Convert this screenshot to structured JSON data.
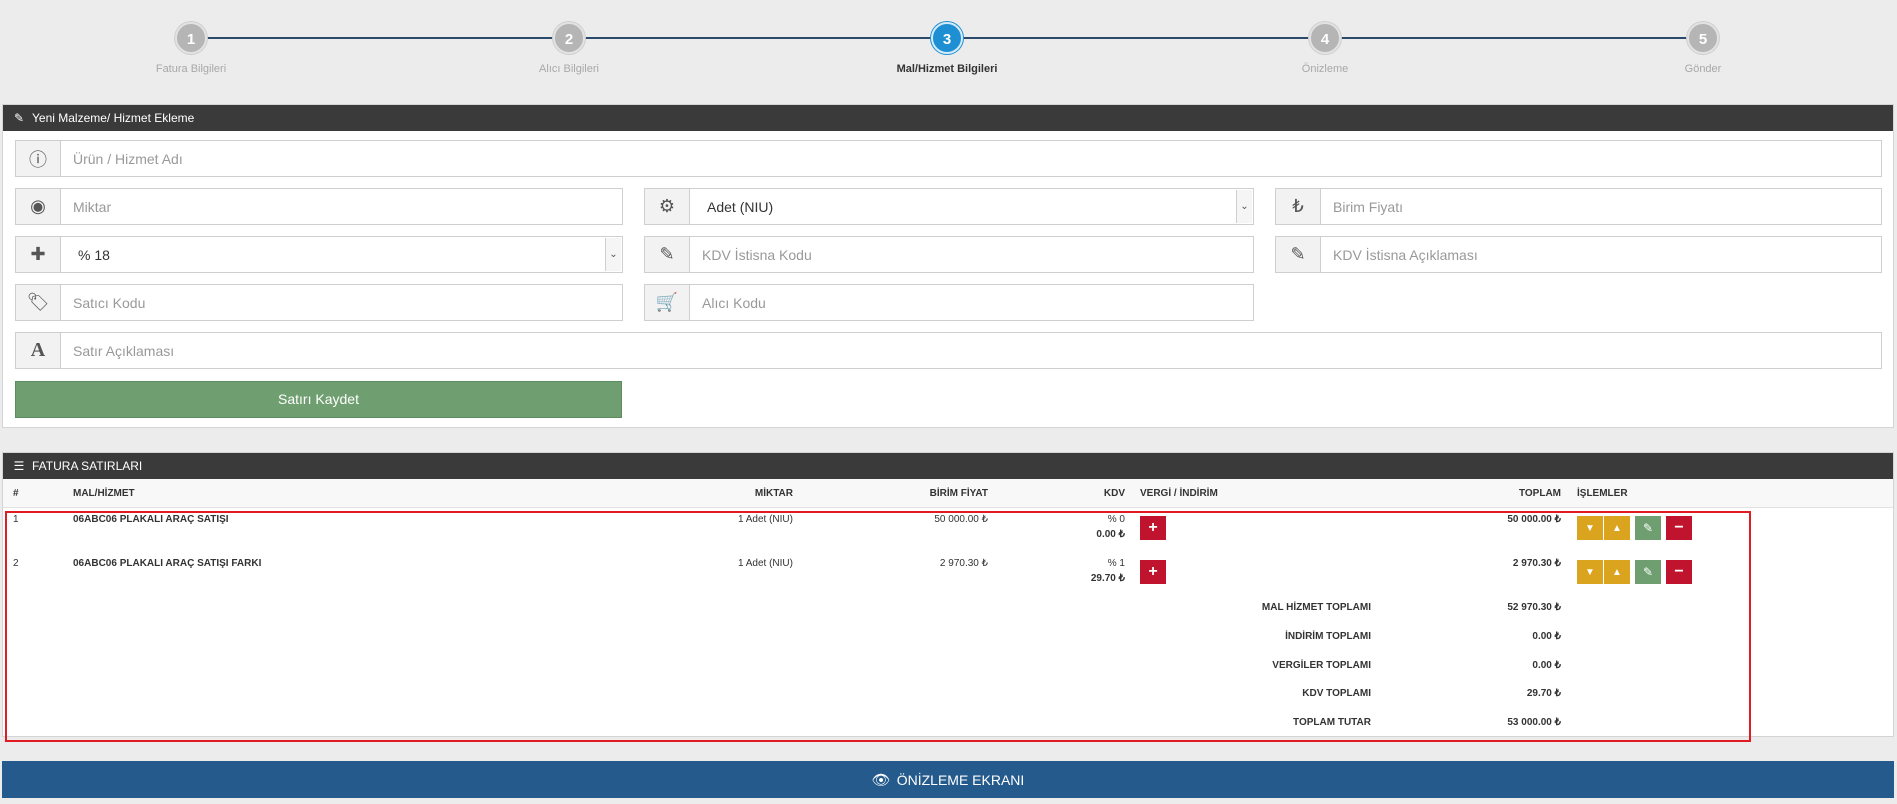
{
  "wizard": {
    "steps": [
      {
        "num": "1",
        "label": "Fatura Bilgileri"
      },
      {
        "num": "2",
        "label": "Alıcı Bilgileri"
      },
      {
        "num": "3",
        "label": "Mal/Hizmet Bilgileri"
      },
      {
        "num": "4",
        "label": "Önizleme"
      },
      {
        "num": "5",
        "label": "Gönder"
      }
    ],
    "active_step": 3
  },
  "form": {
    "title": "Yeni Malzeme/ Hizmet Ekleme",
    "product_name_placeholder": "Ürün / Hizmet Adı",
    "quantity_placeholder": "Miktar",
    "unit_value": "Adet (NIU)",
    "unit_price_placeholder": "Birim Fiyatı",
    "vat_rate_value": "% 18",
    "vat_exemption_code_placeholder": "KDV İstisna Kodu",
    "vat_exemption_desc_placeholder": "KDV İstisna Açıklaması",
    "seller_code_placeholder": "Satıcı Kodu",
    "buyer_code_placeholder": "Alıcı Kodu",
    "line_desc_placeholder": "Satır Açıklaması",
    "save_label": "Satırı Kaydet"
  },
  "table": {
    "title": "FATURA SATIRLARI",
    "headers": {
      "num": "#",
      "item": "MAL/HİZMET",
      "qty": "MİKTAR",
      "unit_price": "BİRİM FİYAT",
      "vat": "KDV",
      "tax_discount": "VERGİ / İNDİRİM",
      "total": "TOPLAM",
      "actions": "İŞLEMLER"
    },
    "rows": [
      {
        "num": "1",
        "item": "06ABC06 PLAKALI ARAÇ SATIŞI",
        "qty": "1 Adet (NIU)",
        "unit_price": "50 000.00 ₺",
        "vat_rate": "% 0",
        "vat_amount": "0.00 ₺",
        "total": "50 000.00 ₺"
      },
      {
        "num": "2",
        "item": "06ABC06 PLAKALI ARAÇ SATIŞI FARKI",
        "qty": "1 Adet (NIU)",
        "unit_price": "2 970.30 ₺",
        "vat_rate": "% 1",
        "vat_amount": "29.70 ₺",
        "total": "2 970.30 ₺"
      }
    ],
    "totals": [
      {
        "label": "MAL HİZMET TOPLAMI",
        "value": "52 970.30 ₺"
      },
      {
        "label": "İNDİRİM TOPLAMI",
        "value": "0.00 ₺"
      },
      {
        "label": "VERGİLER TOPLAMI",
        "value": "0.00 ₺"
      },
      {
        "label": "KDV TOPLAMI",
        "value": "29.70 ₺"
      },
      {
        "label": "TOPLAM TUTAR",
        "value": "53 000.00 ₺"
      }
    ]
  },
  "preview_label": "ÖNİZLEME EKRANI",
  "colors": {
    "panel_header": "#3a3a3a",
    "active_step": "#1e8fd3",
    "save_green": "#6f9f70",
    "danger_red": "#c0132e",
    "warning_yellow": "#dba41f",
    "preview_blue": "#245a8c",
    "highlight": "#e11b22"
  }
}
